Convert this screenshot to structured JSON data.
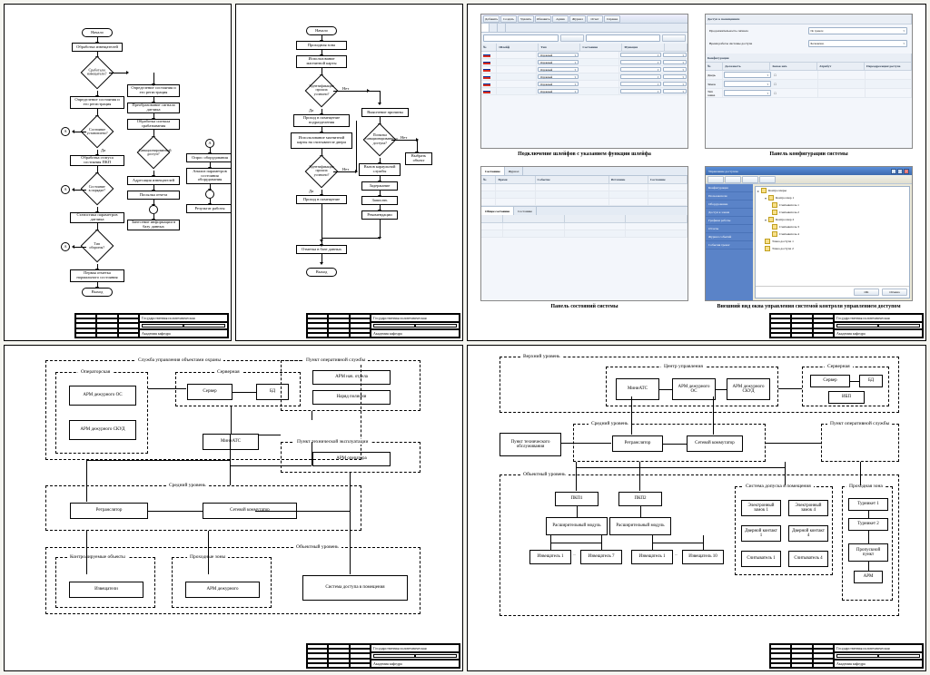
{
  "titleblock": {
    "project": "Государственная политехническая",
    "subtitle": "Академия кафедра"
  },
  "flowchart1": {
    "start": "Начало",
    "n1": "Обработка извещателей",
    "d1": "Сработали извещатели?",
    "n2": "Определение состояния и его регистрация",
    "d2": "Состояние установлено?",
    "n3": "Определение состояния и его регистрация",
    "n4": "Преобразование сигнала датчика",
    "n5": "Обработка сигнала срабатывания",
    "d3": "Санкционированный доступ?",
    "n6": "Обработка статуса состояния ПКП",
    "n7": "Адресация извещателей",
    "n8": "Опрос оборудования",
    "n9": "Анализ параметров состояния оборудования",
    "n10": "Результат работы",
    "n11": "Посылка отчета",
    "n12": "Занесение информации в базу данных",
    "d4": "Состояние в порядке?",
    "n13": "Статистика параметров датчика",
    "d5": "Тип обороны?",
    "n14": "Первая отметка нормального состояния",
    "end": "Выход",
    "yes": "Да",
    "no": "Нет",
    "conn": "A"
  },
  "flowchart2": {
    "start": "Начало",
    "n1": "Проходная зона",
    "n2": "Использование магнитной карты",
    "d1": "Идентификация прошла успешно?",
    "n3": "Проход в помещение подразделения",
    "n4": "Использование магнитной карты на считывателе двери",
    "d2": "Идентификация прошла успешно?",
    "n5": "Проход в помещение",
    "n6": "Отметка в базе данных",
    "n7": "Выяснение причины",
    "d3": "Попытка санкционированного доступа?",
    "n8": "Вызов караульной службы",
    "n9": "Задержание",
    "n10": "Записать",
    "n11": "Рекомендации",
    "n12": "Выбрать объект",
    "end": "Выход",
    "yes": "Да",
    "no": "Нет"
  },
  "screenshots": {
    "captions": {
      "s1": "Подключение шлейфов с указанием функции шлейфа",
      "s2": "Панель конфигурации системы",
      "s3": "Панель состояний системы",
      "s4": "Внешний вид окна управления системой контроля управлением доступом"
    },
    "s1": {
      "toolbar": [
        "Добавить",
        "Создать",
        "Удалить",
        "Обновить",
        "Архив",
        "Журнал",
        "Отчет",
        "Справка"
      ],
      "headers": [
        "№",
        "Шлейф",
        "Тип",
        "Состояние",
        "Функция",
        "",
        ""
      ],
      "cell_drop": "Охранный"
    },
    "s2": {
      "title": "Доступ к помещениям",
      "label1": "Продолжительность сигнала",
      "label2": "Время работы системы доступа",
      "opt1": "По тревоге",
      "opt2": "Бесконечно",
      "conf_title": "Конфигурация",
      "conf_headers": [
        "№",
        "Должность",
        "Замок нач.",
        "Атрибут",
        "Переадресация/доступа"
      ],
      "row1": "Дверь",
      "row2": "Замок",
      "row3": "Тип замка"
    },
    "s3": {
      "tabs": [
        "Состояние",
        "Журнал"
      ],
      "headers": [
        "№",
        "Время",
        "Событие",
        "Источник",
        "Состояние"
      ],
      "footer_tabs": [
        "Общее состояние",
        "Состояние"
      ]
    },
    "s4": {
      "wintitle": "Управление доступом",
      "sidebar": [
        "Конфигурация",
        "Пользователи",
        "Оборудование",
        "Доступ к зонам",
        "Графики работы",
        "Отчеты",
        "Журнал событий",
        "События тревог"
      ],
      "tree": [
        "Контроллеры",
        "Контроллер 1",
        "Считыватель 1",
        "Считыватель 2",
        "Контроллер 2",
        "Считыватель 3",
        "Считыватель 4",
        "Точка доступа 1",
        "Точка доступа 2"
      ],
      "ok": "OK",
      "cancel": "Отмена"
    }
  },
  "block1": {
    "g1": "Служба управления объектами охраны",
    "g1a": "Операторская",
    "g1b": "Серверная",
    "g2": "Пункт оперативной службы",
    "g3": "Пункт технической эксплуатации",
    "g4": "Средний уровень",
    "g5": "Объектный уровень",
    "g5a": "Контролируемые объекты",
    "g5b": "Проходные зоны",
    "b1": "АРМ дежурного ОС",
    "b2": "АРМ дежурного СКУД",
    "b3": "Сервер",
    "b4": "БД",
    "b5": "МиниАТС",
    "b6": "АРМ нач. отдела",
    "b7": "Наряд полиции",
    "b8": "АРМ оператора",
    "b9": "Ретранслятор",
    "b10": "Сетевой коммутатор",
    "b11": "Извещатели",
    "b12": "АРМ дежурного",
    "b13": "Система доступа в помещения"
  },
  "block2": {
    "g1": "Верхний уровень",
    "g1a": "Центр управления",
    "g1b": "Серверная",
    "g2": "Средний уровень",
    "g2r": "Пункт оперативной службы",
    "g3": "Объектный уровень",
    "g3a": "Система допуска в помещения",
    "g3b": "Проходная зона",
    "b1": "МиниАТС",
    "b2": "АРМ дежурного ОС",
    "b3": "АРМ дежурного СКУД",
    "b4": "Сервер",
    "b5": "БД",
    "b6": "ИБП",
    "b7": "Пункт технического обслуживания",
    "b8": "Ретранслятор",
    "b9": "Сетевой коммутатор",
    "b10": "ПКП1",
    "b11": "ПКП2",
    "b12": "Расширительный модуль",
    "b13": "Расширительный модуль",
    "b14": "Извещатель 1",
    "b15": "Извещатель 7",
    "b16": "Извещатель 1",
    "b17": "Извещатель 10",
    "b18": "Электронный замок 1",
    "b19": "Электронный замок 4",
    "b20": "Дверной контакт 1",
    "b21": "Дверной контакт 4",
    "b22": "Считыватель 1",
    "b23": "Считыватель 4",
    "b24": "Турникет 1",
    "b25": "Турникет 2",
    "b26": "Пропускной пункт",
    "b27": "АРМ",
    "dots": "..."
  }
}
